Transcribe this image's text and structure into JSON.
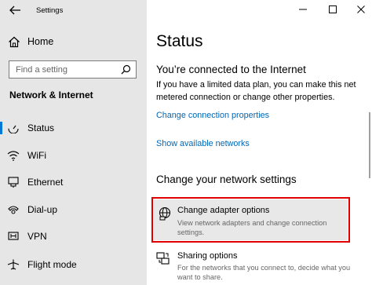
{
  "window": {
    "title": "Settings",
    "controls": [
      "minimize-icon",
      "maximize-icon",
      "close-icon"
    ]
  },
  "sidebar": {
    "home_label": "Home",
    "search_placeholder": "Find a setting",
    "section_title": "Network & Internet",
    "items": [
      {
        "label": "Status",
        "icon": "status-icon",
        "active": true
      },
      {
        "label": "WiFi",
        "icon": "wifi-icon",
        "active": false
      },
      {
        "label": "Ethernet",
        "icon": "ethernet-icon",
        "active": false
      },
      {
        "label": "Dial-up",
        "icon": "dialup-icon",
        "active": false
      },
      {
        "label": "VPN",
        "icon": "vpn-icon",
        "active": false
      },
      {
        "label": "Flight mode",
        "icon": "airplane-icon",
        "active": false
      }
    ]
  },
  "main": {
    "title": "Status",
    "connected_heading": "You’re connected to the Internet",
    "connected_text": "If you have a limited data plan, you can make this net metered connection or change other properties.",
    "link_change_props": "Change connection properties",
    "link_show_networks": "Show available networks",
    "change_heading": "Change your network settings",
    "adapter": {
      "title": "Change adapter options",
      "desc": "View network adapters and change connection settings."
    },
    "sharing": {
      "title": "Sharing options",
      "desc": "For the networks that you connect to, decide what you want to share."
    }
  },
  "colors": {
    "accent": "#0078d7",
    "link": "#0067b8",
    "highlight_border": "#e00000",
    "sidebar_bg": "#e6e6e6"
  }
}
